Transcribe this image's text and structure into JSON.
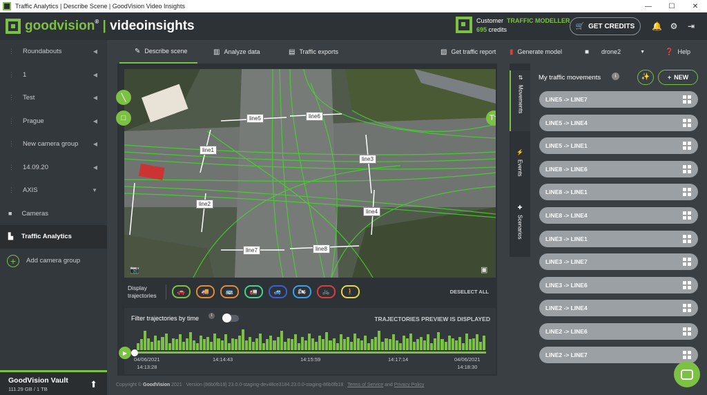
{
  "window": {
    "title": "Traffic Analytics | Describe Scene | GoodVision Video Insights",
    "min": "—",
    "max": "☐",
    "close": "✕"
  },
  "brand": {
    "goodvision": "goodvision",
    "reg": "®",
    "sep": "|",
    "video": "videoinsights"
  },
  "customer": {
    "label": "Customer",
    "plan": "TRAFFIC MODELLER",
    "credits_value": "695",
    "credits_label": "credits"
  },
  "get_credits": "GET CREDITS",
  "sidebar": {
    "items": [
      {
        "label": "Roundabouts"
      },
      {
        "label": "1"
      },
      {
        "label": "Test"
      },
      {
        "label": "Prague"
      },
      {
        "label": "New camera group"
      },
      {
        "label": "14.09.20"
      },
      {
        "label": "AXIS"
      }
    ],
    "cameras": "Cameras",
    "traffic_analytics": "Traffic Analytics",
    "add_group": "Add camera group"
  },
  "vault": {
    "title": "GoodVision Vault",
    "usage": "111.29 GB / 1 TB"
  },
  "tabs": {
    "describe": "Describe scene",
    "analyze": "Analyze data",
    "exports": "Traffic exports",
    "report": "Get traffic report",
    "generate": "Generate model",
    "camera": "drone2",
    "help": "Help"
  },
  "video_lines": [
    "line1",
    "line2",
    "line3",
    "line4",
    "line5",
    "line6",
    "line7",
    "line8"
  ],
  "tt_button": "Tт",
  "display": {
    "label_line1": "Display",
    "label_line2": "trajectories",
    "deselect": "DESELECT ALL"
  },
  "vehicles": [
    {
      "icon": "🚗",
      "color": "#7cc143"
    },
    {
      "icon": "🚚",
      "color": "#e08a3c"
    },
    {
      "icon": "🚌",
      "color": "#e08a3c"
    },
    {
      "icon": "🚛",
      "color": "#4ccf8a"
    },
    {
      "icon": "🚙",
      "color": "#3a5fd8"
    },
    {
      "icon": "🏍",
      "color": "#3aa0e8"
    },
    {
      "icon": "🚲",
      "color": "#e03c3c"
    },
    {
      "icon": "🚶",
      "color": "#e0d84a"
    }
  ],
  "timeline": {
    "filter_label": "Filter trajectories by time",
    "info": "i",
    "status": "TRAJECTORIES PREVIEW IS DISPLAYED",
    "start_date": "04/06/2021",
    "start_time": "14:13:28",
    "t1": "14:14:43",
    "t2": "14:15:59",
    "t3": "14:17:14",
    "end_date": "04/06/2021",
    "end_time": "14:18:30",
    "bar_levels": [
      0.3,
      0.45,
      0.8,
      0.5,
      0.35,
      0.6,
      0.4,
      0.55,
      0.7,
      0.3,
      0.5,
      0.45,
      0.65,
      0.35,
      0.5,
      0.75,
      0.4,
      0.3,
      0.6,
      0.45,
      0.55,
      0.35,
      0.7,
      0.5,
      0.4,
      0.65,
      0.3,
      0.5,
      0.45,
      0.6,
      0.85,
      0.4,
      0.55,
      0.35,
      0.5,
      0.7,
      0.3,
      0.45,
      0.6,
      0.4,
      0.55,
      0.8,
      0.35,
      0.5,
      0.45,
      0.65,
      0.3,
      0.55,
      0.4,
      0.7,
      0.5,
      0.35,
      0.6,
      0.45,
      0.75,
      0.4,
      0.5,
      0.3,
      0.65,
      0.45,
      0.55,
      0.35,
      0.7,
      0.5,
      0.4,
      0.6,
      0.3,
      0.45,
      0.55,
      0.8,
      0.35,
      0.5,
      0.45,
      0.65,
      0.4,
      0.3,
      0.6,
      0.5,
      0.7,
      0.35,
      0.45,
      0.55,
      0.4,
      0.65,
      0.3,
      0.5,
      0.75,
      0.45,
      0.35,
      0.6,
      0.5,
      0.4,
      0.55,
      0.3,
      0.7,
      0.45,
      0.5,
      0.65,
      0.35,
      0.6
    ]
  },
  "footer": {
    "copyright": "Copyright © ",
    "brand": "GoodVision",
    "year": " 2021",
    "version": "Version (86b0fb18) 23.0.0-staging-dev48ce3184.23.0.0-staging-86b0fb18",
    "terms": "Terms of Service",
    "and": " and ",
    "privacy": "Privacy Policy"
  },
  "vtabs": {
    "movements": "Movements",
    "events": "Events",
    "scenarios": "Scenarios"
  },
  "right": {
    "heading": "My traffic movements",
    "info": "i",
    "new": "NEW",
    "movements": [
      "LINE5 -> LINE7",
      "LINE5 -> LINE4",
      "LINE5 -> LINE1",
      "LINE8 -> LINE6",
      "LINE8 -> LINE1",
      "LINE8 -> LINE4",
      "LINE3 -> LINE1",
      "LINE3 -> LINE7",
      "LINE3 -> LINE6",
      "LINE2 -> LINE4",
      "LINE2 -> LINE6",
      "LINE2 -> LINE7"
    ]
  },
  "colors": {
    "accent": "#7cc143",
    "header": "#2d3236",
    "sidebar": "#33383c",
    "pill": "#9aa0a4"
  }
}
